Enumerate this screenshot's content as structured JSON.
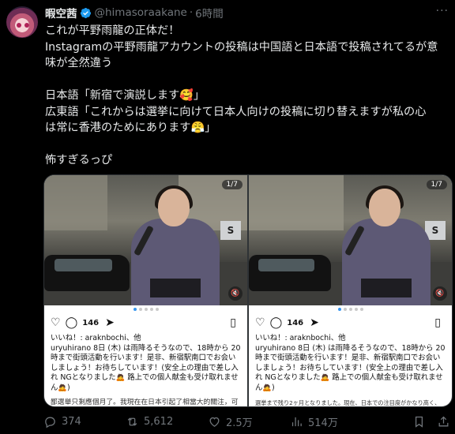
{
  "author": {
    "name": "暇空茜",
    "handle": "@himasoraakane",
    "separator": "·",
    "time": "6時間",
    "more": "···"
  },
  "tweet_lines": [
    "これが平野雨龍の正体だ！",
    "Instagramの平野雨龍アカウントの投稿は中国語と日本語で投稿されてるが意",
    "味が全然違う",
    "",
    "日本語「新宿で演説します🥰」",
    "広東語「これからは選挙に向けて日本人向けの投稿に切り替えますが私の心",
    "は常に香港のためにあります😤」",
    "",
    "怖すぎるっぴ"
  ],
  "images": [
    {
      "page_badge": "1/7",
      "sign": "S",
      "comment_count": "146",
      "liked_by": "いいね！: araknbochi、他",
      "caption": "uryuhirano 8日 (木) は雨降るそうなので、18時から 20時まで街頭活動を行います！是非、新宿駅南口でお会いしましょう！お待ちしています！(安全上の理由で差し入れ NGとなりました🙇 路上での個人献金も受け取れません🙇)",
      "foreign_text": "鄙選舉只剩應個月了。我現在在日本引起了相當大的關注，可能會把Instagram的內容轉為主要向日本人發佈的貼文。但我的心從有改變。我一直會與香港人揮落去。希望大家不要忘記我過去的行動與發"
    },
    {
      "page_badge": "1/7",
      "sign": "S",
      "comment_count": "146",
      "liked_by": "いいね！: araknbochi、他",
      "caption": "uryuhirano 8日 (木) は雨降るそうなので、18時から 20時まで街頭活動を行います！是非、新宿駅南口でお会いしましょう！お待ちしています！(安全上の理由で差し入れ NGとなりました🙇 路上での個人献金も受け取れません🙇)",
      "foreign_text": "選挙まで残り2ヶ月となりました。現在、日本での注目度がかなり高く、インスタグラムの投稿も主に日本人に向けたものに切り替えるかもしれません。しかし、私の心は変わりません"
    }
  ],
  "actions": {
    "replies": "374",
    "retweets": "5,612",
    "likes": "2.5万",
    "views": "514万"
  },
  "colors": {
    "background": "#000000",
    "text": "#e7e9ea",
    "muted": "#71767b",
    "verified": "#1d9bf0"
  }
}
